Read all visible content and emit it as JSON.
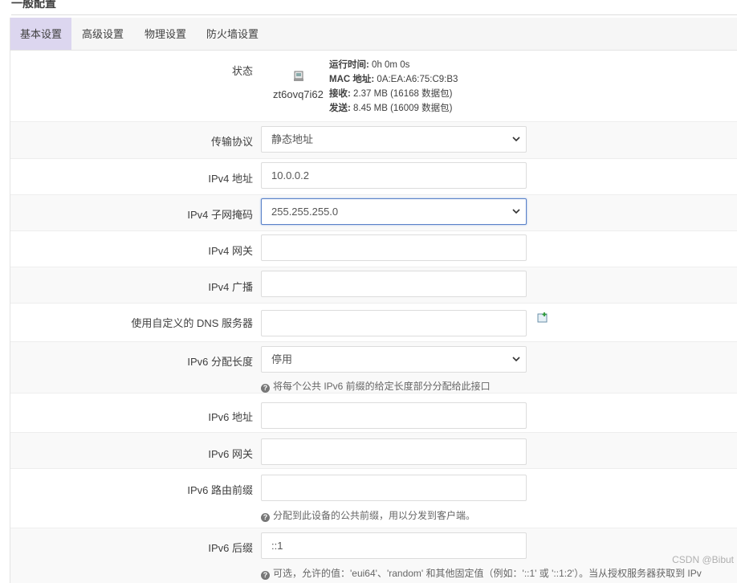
{
  "section_title": "一般配置",
  "tabs": [
    {
      "label": "基本设置",
      "active": true
    },
    {
      "label": "高级设置",
      "active": false
    },
    {
      "label": "物理设置",
      "active": false
    },
    {
      "label": "防火墙设置",
      "active": false
    }
  ],
  "status": {
    "label": "状态",
    "iface_name": "zt6ovq7i62",
    "uptime_key": "运行时间:",
    "uptime_val": "0h 0m 0s",
    "mac_key": "MAC 地址:",
    "mac_val": "0A:EA:A6:75:C9:B3",
    "rx_key": "接收:",
    "rx_val": "2.37 MB (16168 数据包)",
    "tx_key": "发送:",
    "tx_val": "8.45 MB (16009 数据包)"
  },
  "fields": {
    "protocol": {
      "label": "传输协议",
      "value": "静态地址"
    },
    "ipv4_addr": {
      "label": "IPv4 地址",
      "value": "10.0.0.2"
    },
    "ipv4_mask": {
      "label": "IPv4 子网掩码",
      "value": "255.255.255.0"
    },
    "ipv4_gw": {
      "label": "IPv4 网关",
      "value": ""
    },
    "ipv4_bcast": {
      "label": "IPv4 广播",
      "value": ""
    },
    "dns": {
      "label": "使用自定义的 DNS 服务器",
      "value": ""
    },
    "ipv6_assign": {
      "label": "IPv6 分配长度",
      "value": "停用",
      "hint": "将每个公共 IPv6 前缀的给定长度部分分配给此接口"
    },
    "ipv6_addr": {
      "label": "IPv6 地址",
      "value": ""
    },
    "ipv6_gw": {
      "label": "IPv6 网关",
      "value": ""
    },
    "ipv6_prefix": {
      "label": "IPv6 路由前缀",
      "value": "",
      "hint": "分配到此设备的公共前缀，用以分发到客户端。"
    },
    "ipv6_suffix": {
      "label": "IPv6 后缀",
      "value": "::1",
      "hint": "可选，允许的值：'eui64'、'random' 和其他固定值（例如：'::1' 或 '::1:2'）。当从授权服务器获取到 IPv"
    }
  },
  "watermark": "CSDN @Bibut"
}
